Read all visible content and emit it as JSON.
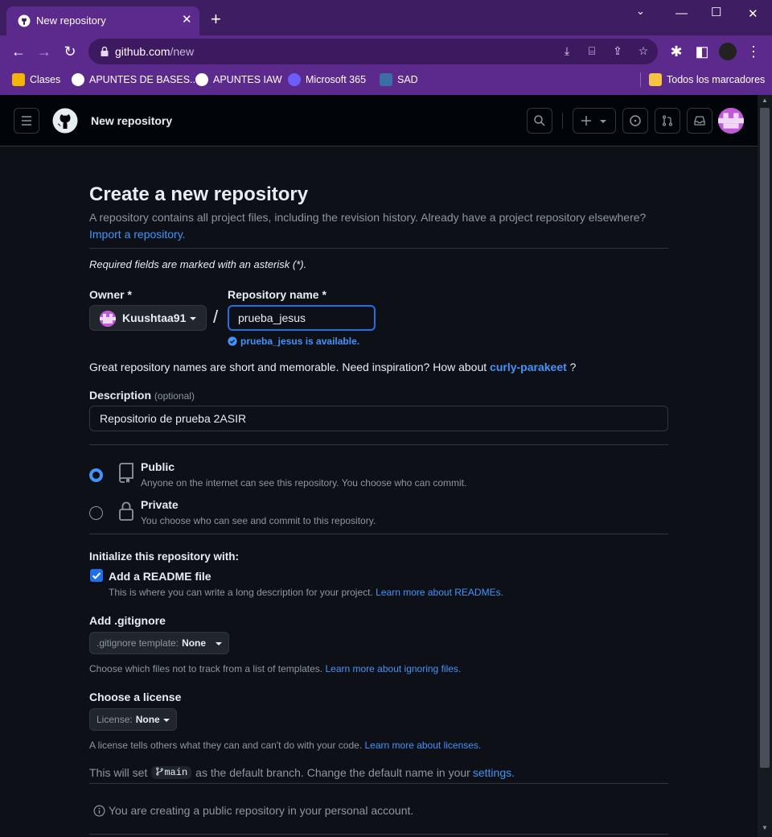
{
  "browser": {
    "tab_title": "New repository",
    "url_host": "github.com",
    "url_path": "/new",
    "bookmarks": [
      {
        "label": "Clases",
        "color": "#f5b400"
      },
      {
        "label": "APUNTES DE BASES...",
        "color": "#ffffff"
      },
      {
        "label": "APUNTES IAW",
        "color": "#ffffff"
      },
      {
        "label": "Microsoft 365",
        "color": "#6d5dfc"
      },
      {
        "label": "SAD",
        "color": "#3a6ea5"
      }
    ],
    "all_bookmarks": "Todos los marcadores"
  },
  "header": {
    "title": "New repository"
  },
  "page": {
    "heading": "Create a new repository",
    "subtitle": "A repository contains all project files, including the revision history. Already have a project repository elsewhere?",
    "import_link": "Import a repository.",
    "required_note": "Required fields are marked with an asterisk (*).",
    "owner_label": "Owner *",
    "owner_name": "Kuushtaa91",
    "repo_label": "Repository name *",
    "repo_value": "prueba_jesus",
    "available_msg": "prueba_jesus is available.",
    "great_text": "Great repository names are short and memorable. Need inspiration? How about",
    "suggestion": "curly-parakeet",
    "great_end": "?",
    "description_label": "Description",
    "description_optional": "(optional)",
    "description_value": "Repositorio de prueba 2ASIR",
    "visibility": {
      "public_title": "Public",
      "public_desc": "Anyone on the internet can see this repository. You choose who can commit.",
      "private_title": "Private",
      "private_desc": "You choose who can see and commit to this repository.",
      "selected": "public"
    },
    "init_label": "Initialize this repository with:",
    "readme_label": "Add a README file",
    "readme_checked": true,
    "readme_desc": "This is where you can write a long description for your project.",
    "readme_link": "Learn more about READMEs.",
    "gitignore_label": "Add .gitignore",
    "gitignore_prefix": ".gitignore template:",
    "gitignore_value": "None",
    "gitignore_desc": "Choose which files not to track from a list of templates.",
    "gitignore_link": "Learn more about ignoring files.",
    "license_label": "Choose a license",
    "license_prefix": "License:",
    "license_value": "None",
    "license_desc": "A license tells others what they can and can't do with your code.",
    "license_link": "Learn more about licenses.",
    "branch_pre": "This will set",
    "branch_name": "main",
    "branch_post": "as the default branch. Change the default name in your",
    "settings_link": "settings",
    "info_text": "You are creating a public repository in your personal account."
  }
}
